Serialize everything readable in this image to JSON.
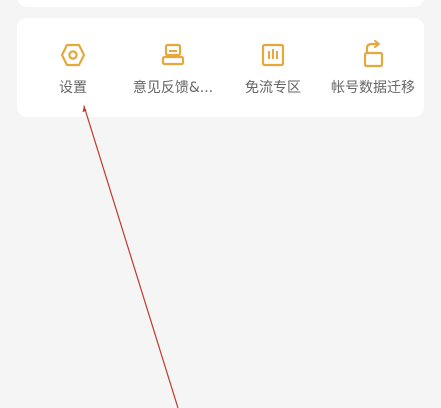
{
  "tools": [
    {
      "label": "设置",
      "icon": "hexagon-settings-icon"
    },
    {
      "label": "意见反馈&...",
      "icon": "feedback-printer-icon"
    },
    {
      "label": "免流专区",
      "icon": "chart-box-icon"
    },
    {
      "label": "帐号数据迁移",
      "icon": "migrate-lock-icon"
    }
  ],
  "colors": {
    "icon_accent": "#e6a83a",
    "label_text": "#666666",
    "annotation_line": "#c0392b",
    "card_bg": "#ffffff",
    "page_bg": "#f5f5f5"
  }
}
